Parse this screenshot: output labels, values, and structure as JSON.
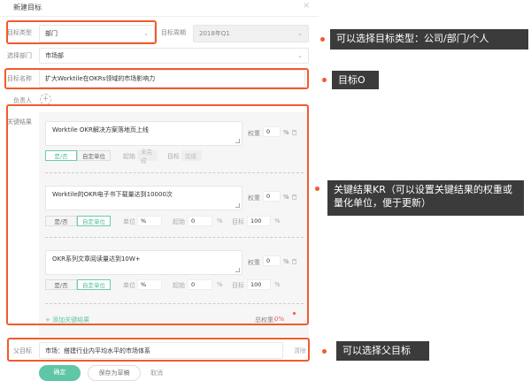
{
  "dialog": {
    "title": "新建目标",
    "close": "×"
  },
  "form": {
    "type_label": "目标类型",
    "type_value": "部门",
    "period_label": "目标周期",
    "period_value": "2018年Q1",
    "dept_label": "选择部门",
    "dept_value": "市场部",
    "name_label": "目标名称",
    "name_value": "扩大Worktile在OKRs领域的市场影响力",
    "owner_label": "负责人",
    "owner_add": "+",
    "kr_label": "关键结果",
    "krs": [
      {
        "text": "Worktile OKR解决方案落地页上线",
        "weight_label": "权重",
        "weight": "0",
        "pct": "%",
        "mode_yesno": "是/否",
        "mode_custom": "自定单位",
        "active": "yesno",
        "start_label": "起始",
        "start": "未完成",
        "target_label": "目标",
        "target": "完成"
      },
      {
        "text": "Worktile的OKR电子书下载量达到10000次",
        "weight_label": "权重",
        "weight": "0",
        "pct": "%",
        "mode_yesno": "是/否",
        "mode_custom": "自定单位",
        "active": "custom",
        "unit_label": "单位",
        "unit": "%",
        "start_label": "起始",
        "start": "0",
        "target_label": "目标",
        "target": "100"
      },
      {
        "text": "OKR系列文章阅读量达到10W+",
        "weight_label": "权重",
        "weight": "0",
        "pct": "%",
        "mode_yesno": "是/否",
        "mode_custom": "自定单位",
        "active": "custom",
        "unit_label": "单位",
        "unit": "%",
        "start_label": "起始",
        "start": "0",
        "target_label": "目标",
        "target": "100"
      }
    ],
    "add_kr": "+ 添加关键结果",
    "total_weight_label": "总权重:",
    "total_weight": "0%",
    "parent_label": "父目标",
    "parent_value": "市场：搭建行业内平均水平的市场体系",
    "parent_clear": "清除"
  },
  "buttons": {
    "ok": "确定",
    "draft": "保存为草稿",
    "cancel": "取消"
  },
  "annotations": {
    "type": "可以选择目标类型：公司/部门/个人",
    "objective": "目标O",
    "kr": "关键结果KR（可以设置关键结果的权重或量化单位，便于更新）",
    "parent": "可以选择父目标"
  },
  "colors": {
    "accent": "#f25a2c",
    "green": "#5fc6a8"
  }
}
